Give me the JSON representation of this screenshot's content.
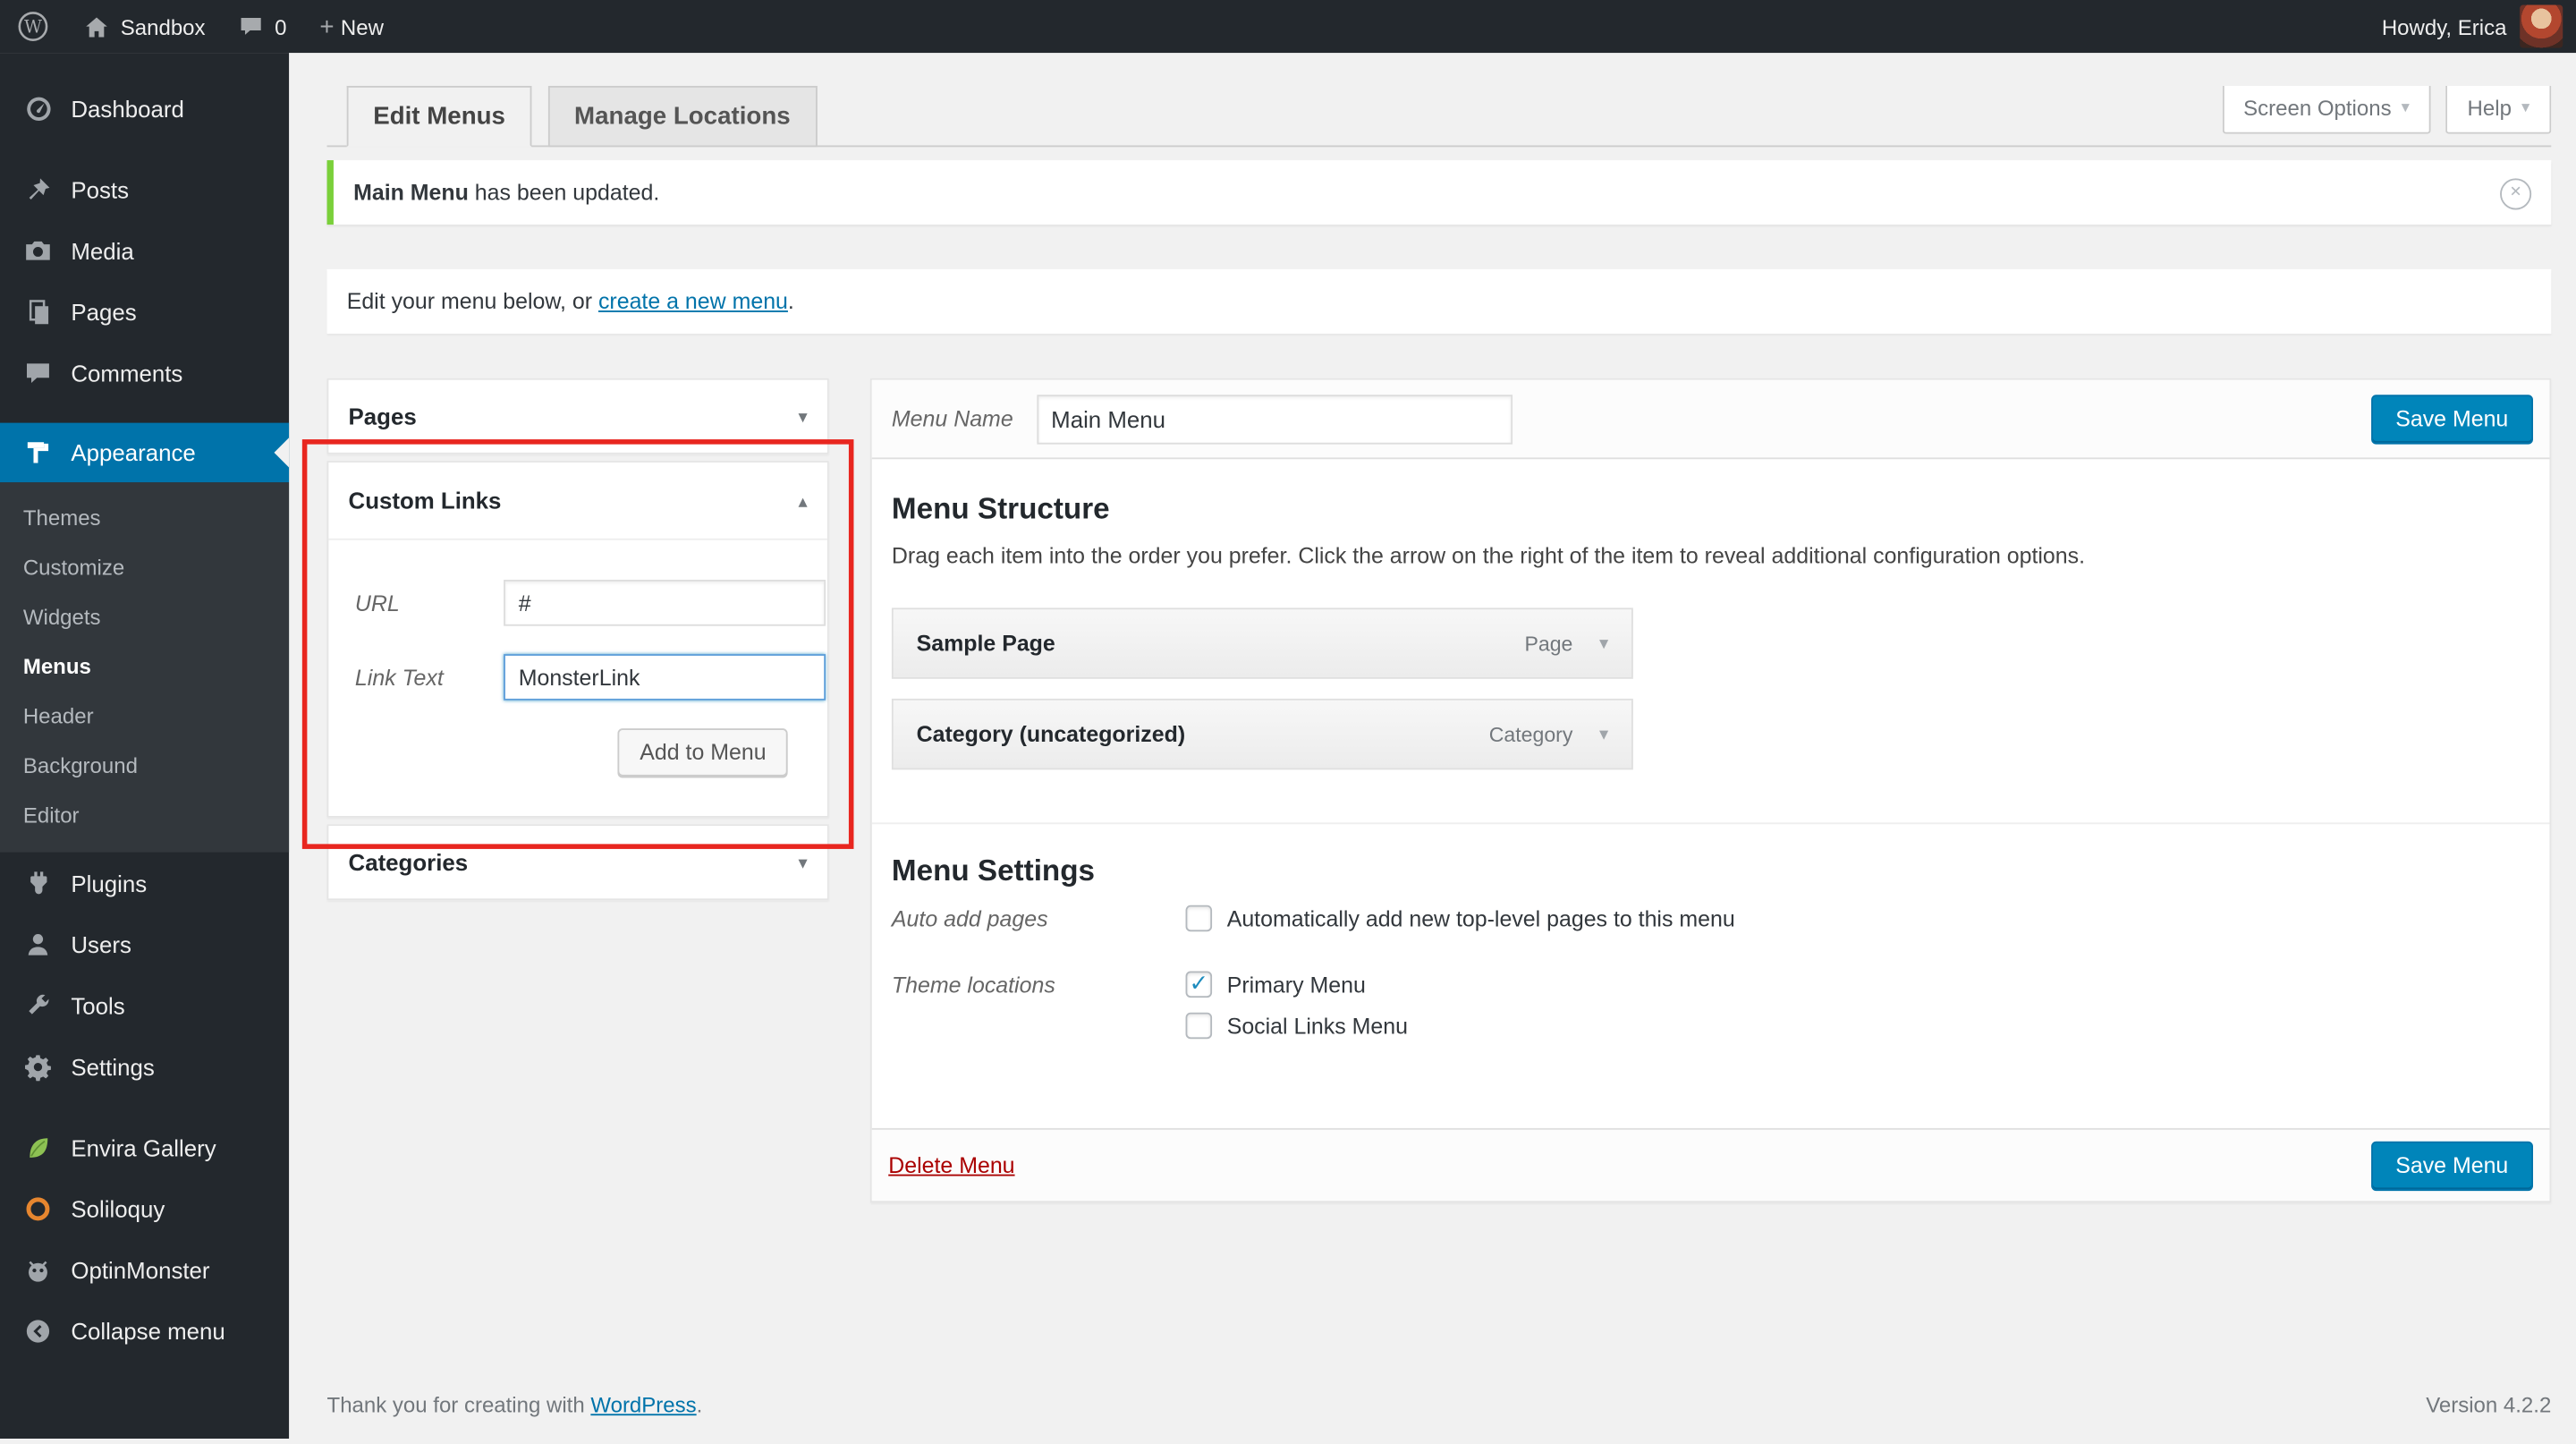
{
  "admin_bar": {
    "site_name": "Sandbox",
    "comment_count": "0",
    "new_label": "New",
    "howdy": "Howdy, Erica"
  },
  "icons": {
    "plus": "+",
    "chevron_down": "▾",
    "chevron_up": "▴",
    "check": "✓",
    "dismiss": "✕"
  },
  "sidebar": {
    "items": [
      {
        "label": "Dashboard"
      },
      {
        "label": "Posts"
      },
      {
        "label": "Media"
      },
      {
        "label": "Pages"
      },
      {
        "label": "Comments"
      },
      {
        "label": "Appearance"
      },
      {
        "label": "Plugins"
      },
      {
        "label": "Users"
      },
      {
        "label": "Tools"
      },
      {
        "label": "Settings"
      },
      {
        "label": "Envira Gallery"
      },
      {
        "label": "Soliloquy"
      },
      {
        "label": "OptinMonster"
      },
      {
        "label": "Collapse menu"
      }
    ],
    "appearance_submenu": [
      "Themes",
      "Customize",
      "Widgets",
      "Menus",
      "Header",
      "Background",
      "Editor"
    ]
  },
  "page": {
    "screen_options_label": "Screen Options",
    "help_label": "Help"
  },
  "tabs": {
    "edit_menus": "Edit Menus",
    "manage_locations": "Manage Locations"
  },
  "notice": {
    "title": "Main Menu",
    "message": " has been updated."
  },
  "intro": {
    "prefix": "Edit your menu below, or ",
    "link_text": "create a new menu",
    "suffix": "."
  },
  "panels": {
    "pages_title": "Pages",
    "custom_links": {
      "title": "Custom Links",
      "url_label": "URL",
      "url_value": "#",
      "link_text_label": "Link Text",
      "link_text_value": "MonsterLink",
      "add_button_label": "Add to Menu"
    },
    "categories_title": "Categories"
  },
  "editor": {
    "menu_name_label": "Menu Name",
    "menu_name_value": "Main Menu",
    "save_button_label": "Save Menu",
    "structure_heading": "Menu Structure",
    "structure_help": "Drag each item into the order you prefer. Click the arrow on the right of the item to reveal additional configuration options.",
    "menu_items": [
      {
        "label": "Sample Page",
        "type": "Page"
      },
      {
        "label": "Category (uncategorized)",
        "type": "Category"
      }
    ],
    "settings_heading": "Menu Settings",
    "auto_add_label": "Auto add pages",
    "auto_add_option": "Automatically add new top-level pages to this menu",
    "theme_locations_label": "Theme locations",
    "theme_locations": [
      {
        "label": "Primary Menu",
        "checked": true
      },
      {
        "label": "Social Links Menu",
        "checked": false
      }
    ],
    "delete_label": "Delete Menu"
  },
  "footer": {
    "thanks_prefix": "Thank you for creating with ",
    "thanks_link": "WordPress",
    "thanks_suffix": ".",
    "version": "Version 4.2.2"
  },
  "colors": {
    "admin_dark": "#23282d",
    "accent_blue": "#0073aa",
    "primary_button": "#0085ba",
    "notice_green": "#7ad03a",
    "annotation_red": "#e8261f",
    "content_background": "#f1f1f1"
  }
}
